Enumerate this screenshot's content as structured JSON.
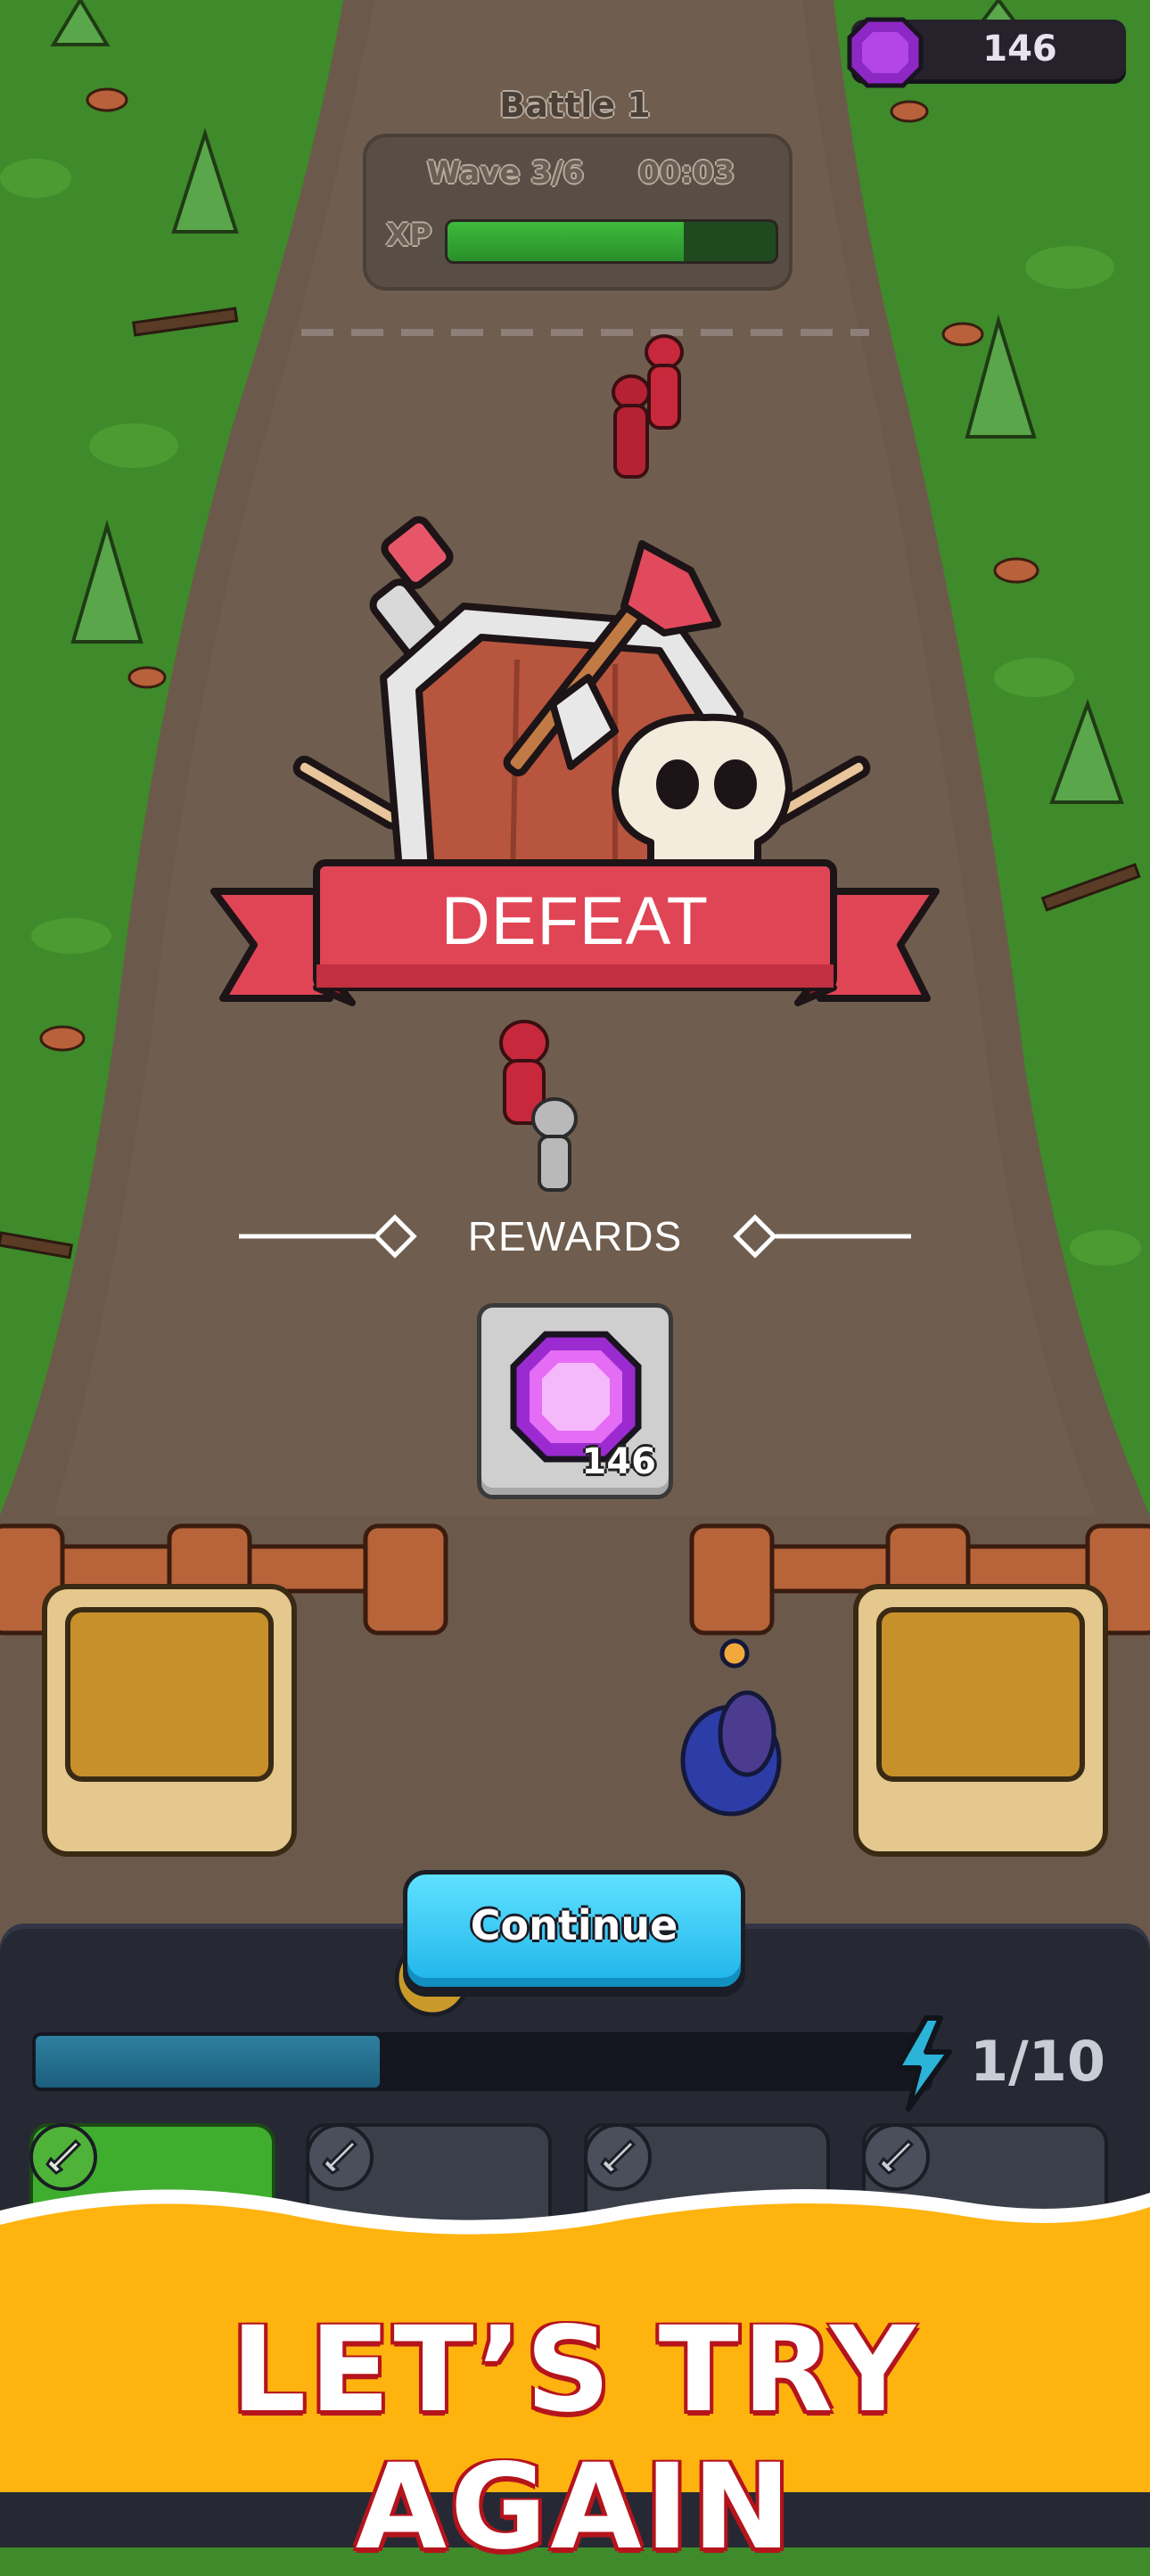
{
  "currency": {
    "gems": "146",
    "icon": "gem-icon",
    "color": "#9b2bd1"
  },
  "battle": {
    "title": "Battle 1",
    "wave": "Wave 3/6",
    "timer": "00:03",
    "xp_label": "XP",
    "xp_progress": 0.72
  },
  "result": {
    "title": "DEFEAT",
    "ribbon_color": "#e04556"
  },
  "rewards": {
    "label": "REWARDS",
    "items": [
      {
        "icon": "gem-icon",
        "amount": "146"
      }
    ]
  },
  "actions": {
    "continue_label": "Continue"
  },
  "energy": {
    "count": "1/10",
    "progress": 0.39,
    "icon": "lightning-icon"
  },
  "unit_slots": [
    {
      "icon": "sword-icon",
      "active": true
    },
    {
      "icon": "sword-icon",
      "active": false
    },
    {
      "icon": "sword-icon",
      "active": false
    },
    {
      "icon": "sword-icon",
      "active": false
    }
  ],
  "banner": {
    "text": "LET’S TRY AGAIN",
    "background": "#ffb30f"
  },
  "colors": {
    "grass": "#3f8a2a",
    "road": "#6b5a4b",
    "accent_button": "#39c6f5"
  }
}
